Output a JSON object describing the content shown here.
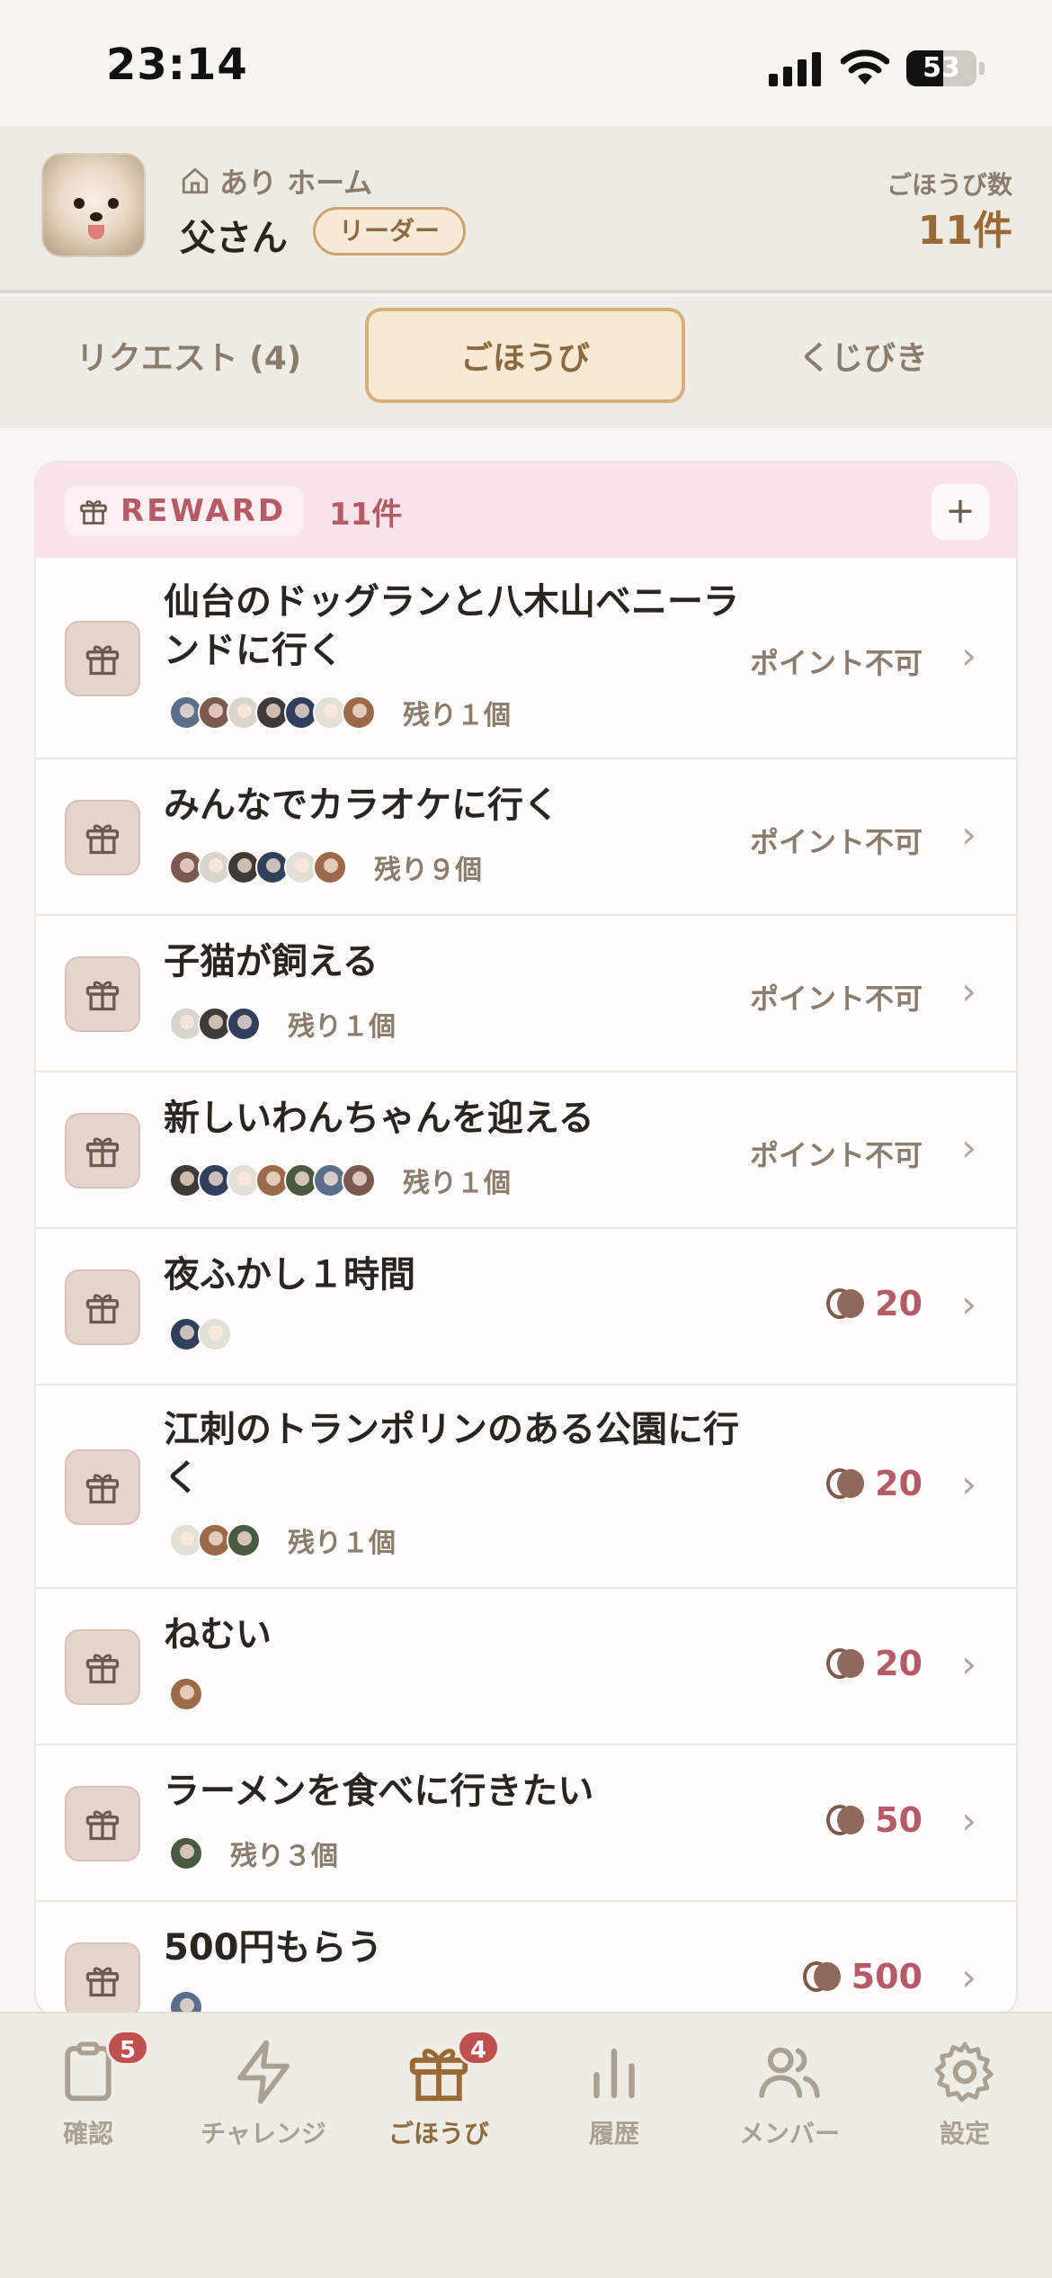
{
  "status_bar": {
    "time": "23:14",
    "battery": "53",
    "battery_level": 0.53
  },
  "header": {
    "home_label": "あり ホーム",
    "user_name": "父さん",
    "role_badge": "リーダー",
    "reward_count_label": "ごほうび数",
    "reward_count": "11件"
  },
  "tabs": [
    {
      "label": "リクエスト (4)",
      "active": false
    },
    {
      "label": "ごほうび",
      "active": true
    },
    {
      "label": "くじびき",
      "active": false
    }
  ],
  "card": {
    "title": "REWARD",
    "count": "11件",
    "add_label": "+",
    "items": [
      {
        "title": "仙台のドッグランと八木山ベニーランドに行く",
        "status": "ポイント不可",
        "avatars": 7,
        "remaining": "残り１個"
      },
      {
        "title": "みんなでカラオケに行く",
        "status": "ポイント不可",
        "avatars": 6,
        "remaining": "残り９個"
      },
      {
        "title": "子猫が飼える",
        "status": "ポイント不可",
        "avatars": 3,
        "remaining": "残り１個"
      },
      {
        "title": "新しいわんちゃんを迎える",
        "status": "ポイント不可",
        "avatars": 7,
        "remaining": "残り１個"
      },
      {
        "title": "夜ふかし１時間",
        "points": "20",
        "avatars": 2,
        "remaining": ""
      },
      {
        "title": "江刺のトランポリンのある公園に行く",
        "points": "20",
        "avatars": 3,
        "remaining": "残り１個"
      },
      {
        "title": "ねむい",
        "points": "20",
        "avatars": 1,
        "remaining": ""
      },
      {
        "title": "ラーメンを食べに行きたい",
        "points": "50",
        "avatars": 1,
        "remaining": "残り３個"
      },
      {
        "title": "500円もらう",
        "points": "500",
        "avatars": 1,
        "remaining": ""
      }
    ]
  },
  "bottom_nav": [
    {
      "label": "確認",
      "icon": "clipboard-icon",
      "badge": "5",
      "active": false
    },
    {
      "label": "チャレンジ",
      "icon": "bolt-icon",
      "badge": "",
      "active": false
    },
    {
      "label": "ごほうび",
      "icon": "gift-icon",
      "badge": "4",
      "active": true
    },
    {
      "label": "履歴",
      "icon": "bar-chart-icon",
      "badge": "",
      "active": false
    },
    {
      "label": "メンバー",
      "icon": "users-icon",
      "badge": "",
      "active": false
    },
    {
      "label": "設定",
      "icon": "gear-icon",
      "badge": "",
      "active": false
    }
  ],
  "colors": {
    "accent": "#b65a68",
    "gold": "#9a6a34",
    "background": "#f8f6f2"
  }
}
